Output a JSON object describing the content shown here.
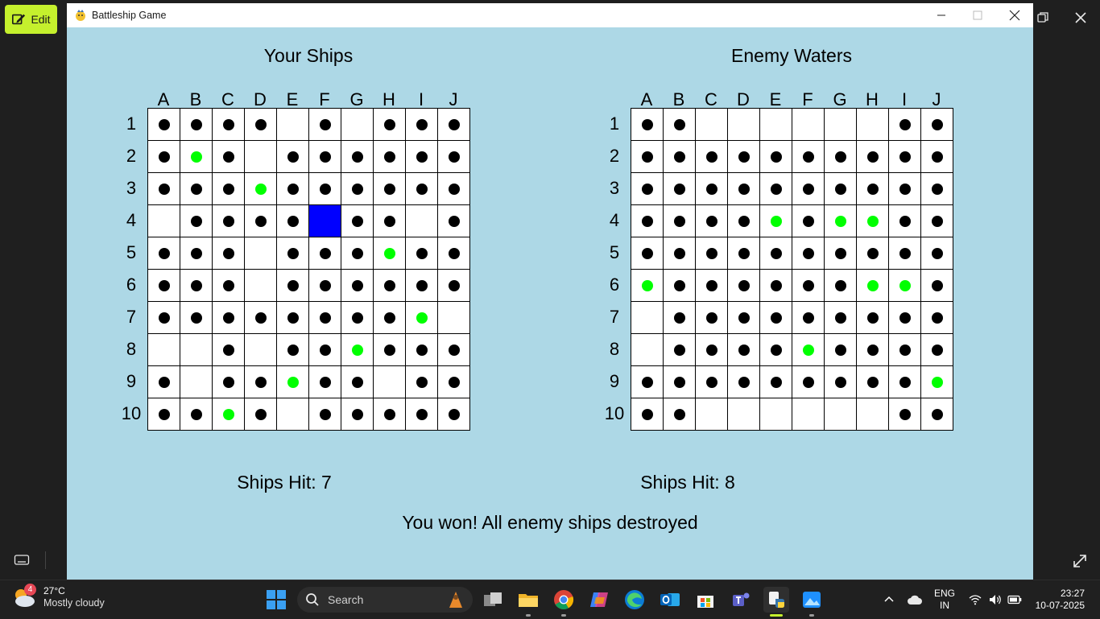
{
  "outer": {
    "edit_label": "Edit"
  },
  "window": {
    "title": "Battleship Game"
  },
  "game": {
    "colors": {
      "background": "#add8e6",
      "ship": "#0000ff",
      "hit": "#00ff00",
      "miss": "#000000",
      "water": "#ffffff"
    },
    "columns": [
      "A",
      "B",
      "C",
      "D",
      "E",
      "F",
      "G",
      "H",
      "I",
      "J"
    ],
    "rows": [
      "1",
      "2",
      "3",
      "4",
      "5",
      "6",
      "7",
      "8",
      "9",
      "10"
    ],
    "player_board": {
      "title": "Your Ships",
      "hits_text": "Ships Hit: 7",
      "legend": {
        "M": "miss",
        "H": "hit",
        "S": "ship",
        ".": "empty"
      },
      "cells": [
        "MMMM.M.MMM",
        "MHM.MMMMMM",
        "MMMHMMMMMM",
        ".MMMMSMM.M",
        "MMM.MMMHMM",
        "MMM.MMMMMM",
        "MMMMMMMMH.",
        "..M.MMHMMM",
        "M.MMHMM.MM",
        "MMHM.MMMMM"
      ]
    },
    "enemy_board": {
      "title": "Enemy Waters",
      "hits_text": "Ships Hit: 8",
      "legend": {
        "M": "miss",
        "H": "hit",
        ".": "empty"
      },
      "cells": [
        "MM......MM",
        "MMMMMMMMMM",
        "MMMMMMMMMM",
        "MMMMHMHHMM",
        "MMMMMMMMMM",
        "HMMMMMMHHM",
        ".MMMMMMMMM",
        ".MMMMHMMMM",
        "MMMMMMMMMH",
        "MM......MM"
      ]
    },
    "status": "You won! All enemy ships destroyed"
  },
  "taskbar": {
    "weather": {
      "temp": "27°C",
      "desc": "Mostly cloudy",
      "badge": "4",
      "icon": "partly-cloudy-icon"
    },
    "search_label": "Search",
    "apps": [
      "task-view-icon",
      "file-explorer-icon",
      "chrome-icon",
      "copilot-icon",
      "edge-icon",
      "outlook-icon",
      "store-icon",
      "teams-icon",
      "python-icon",
      "photos-icon"
    ],
    "language": {
      "line1": "ENG",
      "line2": "IN"
    },
    "clock": {
      "time": "23:27",
      "date": "10-07-2025"
    }
  }
}
